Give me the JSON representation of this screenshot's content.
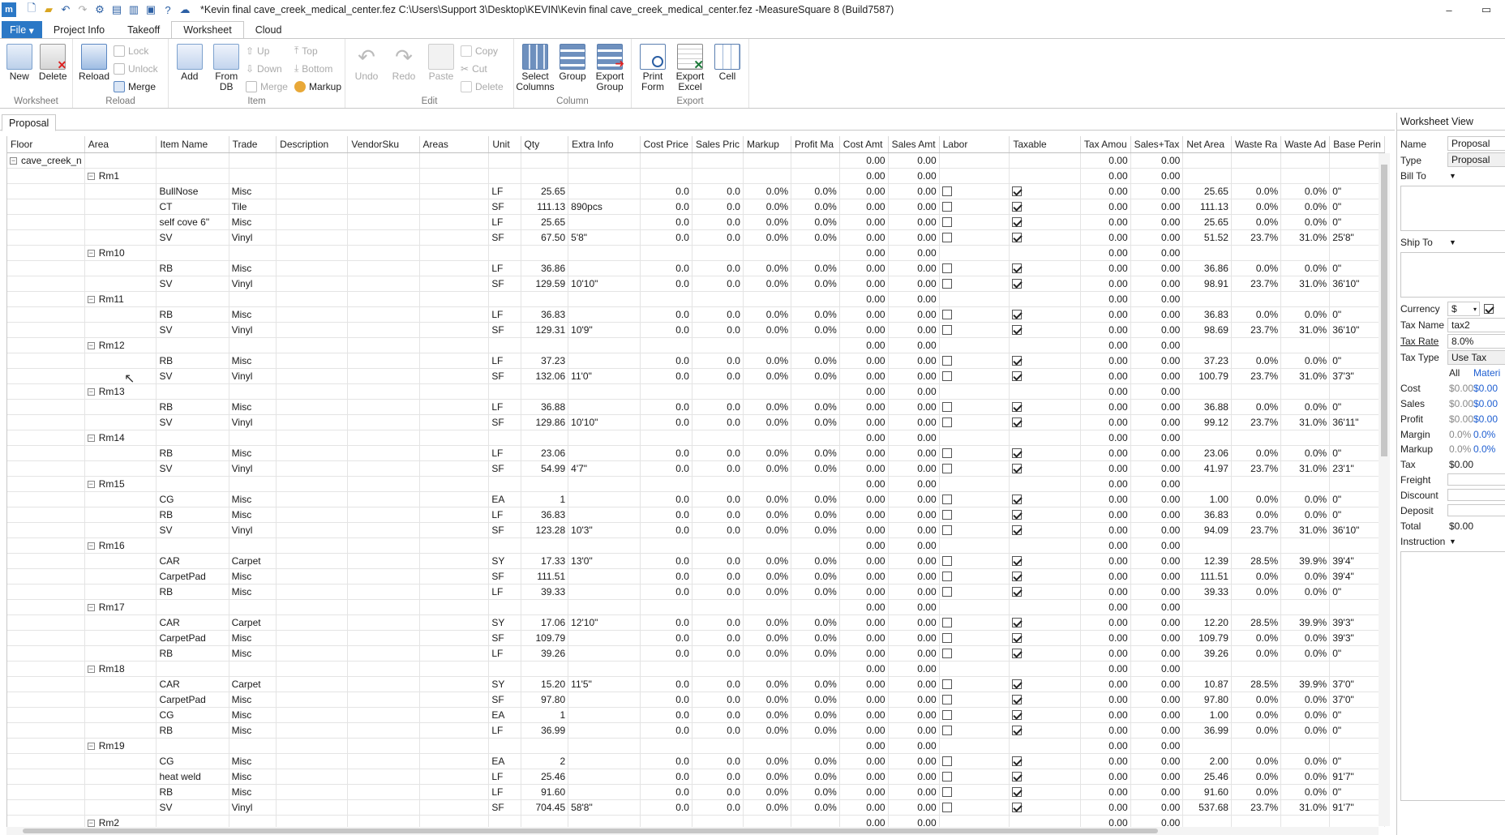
{
  "window": {
    "title": "*Kevin final cave_creek_medical_center.fez C:\\Users\\Support 3\\Desktop\\KEVIN\\Kevin final cave_creek_medical_center.fez -MeasureSquare 8 (Build7587)",
    "logo": "m"
  },
  "ribbon_tabs": [
    "File",
    "Project Info",
    "Takeoff",
    "Worksheet",
    "Cloud"
  ],
  "ribbon": {
    "worksheet_group": {
      "label": "Worksheet",
      "new": "New",
      "delete": "Delete"
    },
    "reload_group": {
      "label": "Reload",
      "reload": "Reload",
      "lock": "Lock",
      "unlock": "Unlock",
      "merge": "Merge"
    },
    "item_group": {
      "label": "Item",
      "add": "Add",
      "from_db": "From\nDB",
      "up": "Up",
      "down": "Down",
      "merge": "Merge",
      "top": "Top",
      "bottom": "Bottom",
      "markup": "Markup"
    },
    "edit_group": {
      "label": "Edit",
      "undo": "Undo",
      "redo": "Redo",
      "paste": "Paste",
      "copy": "Copy",
      "cut": "Cut",
      "delete": "Delete"
    },
    "column_group": {
      "label": "Column",
      "select_columns": "Select\nColumns",
      "group": "Group",
      "export_group": "Export\nGroup"
    },
    "export_group": {
      "label": "Export",
      "print_form": "Print\nForm",
      "export_excel": "Export\nExcel",
      "cell": "Cell"
    }
  },
  "doc_tab": "Proposal",
  "grid": {
    "columns": [
      "Floor",
      "Area",
      "Item Name",
      "Trade",
      "Description",
      "VendorSku",
      "Areas",
      "Unit",
      "Qty",
      "Extra Info",
      "Cost Price",
      "Sales Pric",
      "Markup",
      "Profit Ma",
      "Cost Amt",
      "Sales Amt",
      "Labor",
      "Taxable",
      "Tax Amou",
      "Sales+Tax",
      "Net Area",
      "Waste Ra",
      "Waste Ad",
      "Base Perin"
    ],
    "floor": "cave_creek_n",
    "rooms": [
      {
        "name": "Rm1",
        "items": [
          {
            "item": "BullNose",
            "trade": "Misc",
            "unit": "LF",
            "qty": "25.65",
            "extra": "",
            "net": "25.65",
            "wr": "0.0%",
            "wa": "0.0%",
            "bp": "0\""
          },
          {
            "item": "CT",
            "trade": "Tile",
            "unit": "SF",
            "qty": "111.13",
            "extra": "890pcs",
            "net": "111.13",
            "wr": "0.0%",
            "wa": "0.0%",
            "bp": "0\""
          },
          {
            "item": "self cove 6\"",
            "trade": "Misc",
            "unit": "LF",
            "qty": "25.65",
            "extra": "",
            "net": "25.65",
            "wr": "0.0%",
            "wa": "0.0%",
            "bp": "0\""
          },
          {
            "item": "SV",
            "trade": "Vinyl",
            "unit": "SF",
            "qty": "67.50",
            "extra": "5'8\"",
            "net": "51.52",
            "wr": "23.7%",
            "wa": "31.0%",
            "bp": "25'8\""
          }
        ]
      },
      {
        "name": "Rm10",
        "items": [
          {
            "item": "RB",
            "trade": "Misc",
            "unit": "LF",
            "qty": "36.86",
            "extra": "",
            "net": "36.86",
            "wr": "0.0%",
            "wa": "0.0%",
            "bp": "0\""
          },
          {
            "item": "SV",
            "trade": "Vinyl",
            "unit": "SF",
            "qty": "129.59",
            "extra": "10'10\"",
            "net": "98.91",
            "wr": "23.7%",
            "wa": "31.0%",
            "bp": "36'10\""
          }
        ]
      },
      {
        "name": "Rm11",
        "items": [
          {
            "item": "RB",
            "trade": "Misc",
            "unit": "LF",
            "qty": "36.83",
            "extra": "",
            "net": "36.83",
            "wr": "0.0%",
            "wa": "0.0%",
            "bp": "0\""
          },
          {
            "item": "SV",
            "trade": "Vinyl",
            "unit": "SF",
            "qty": "129.31",
            "extra": "10'9\"",
            "net": "98.69",
            "wr": "23.7%",
            "wa": "31.0%",
            "bp": "36'10\""
          }
        ]
      },
      {
        "name": "Rm12",
        "items": [
          {
            "item": "RB",
            "trade": "Misc",
            "unit": "LF",
            "qty": "37.23",
            "extra": "",
            "net": "37.23",
            "wr": "0.0%",
            "wa": "0.0%",
            "bp": "0\""
          },
          {
            "item": "SV",
            "trade": "Vinyl",
            "unit": "SF",
            "qty": "132.06",
            "extra": "11'0\"",
            "net": "100.79",
            "wr": "23.7%",
            "wa": "31.0%",
            "bp": "37'3\""
          }
        ]
      },
      {
        "name": "Rm13",
        "items": [
          {
            "item": "RB",
            "trade": "Misc",
            "unit": "LF",
            "qty": "36.88",
            "extra": "",
            "net": "36.88",
            "wr": "0.0%",
            "wa": "0.0%",
            "bp": "0\""
          },
          {
            "item": "SV",
            "trade": "Vinyl",
            "unit": "SF",
            "qty": "129.86",
            "extra": "10'10\"",
            "net": "99.12",
            "wr": "23.7%",
            "wa": "31.0%",
            "bp": "36'11\""
          }
        ]
      },
      {
        "name": "Rm14",
        "items": [
          {
            "item": "RB",
            "trade": "Misc",
            "unit": "LF",
            "qty": "23.06",
            "extra": "",
            "net": "23.06",
            "wr": "0.0%",
            "wa": "0.0%",
            "bp": "0\""
          },
          {
            "item": "SV",
            "trade": "Vinyl",
            "unit": "SF",
            "qty": "54.99",
            "extra": "4'7\"",
            "net": "41.97",
            "wr": "23.7%",
            "wa": "31.0%",
            "bp": "23'1\""
          }
        ]
      },
      {
        "name": "Rm15",
        "items": [
          {
            "item": "CG",
            "trade": "Misc",
            "unit": "EA",
            "qty": "1",
            "extra": "",
            "net": "1.00",
            "wr": "0.0%",
            "wa": "0.0%",
            "bp": "0\""
          },
          {
            "item": "RB",
            "trade": "Misc",
            "unit": "LF",
            "qty": "36.83",
            "extra": "",
            "net": "36.83",
            "wr": "0.0%",
            "wa": "0.0%",
            "bp": "0\""
          },
          {
            "item": "SV",
            "trade": "Vinyl",
            "unit": "SF",
            "qty": "123.28",
            "extra": "10'3\"",
            "net": "94.09",
            "wr": "23.7%",
            "wa": "31.0%",
            "bp": "36'10\""
          }
        ]
      },
      {
        "name": "Rm16",
        "items": [
          {
            "item": "CAR",
            "trade": "Carpet",
            "unit": "SY",
            "qty": "17.33",
            "extra": "13'0\"",
            "net": "12.39",
            "wr": "28.5%",
            "wa": "39.9%",
            "bp": "39'4\""
          },
          {
            "item": "CarpetPad",
            "trade": "Misc",
            "unit": "SF",
            "qty": "111.51",
            "extra": "",
            "net": "111.51",
            "wr": "0.0%",
            "wa": "0.0%",
            "bp": "39'4\""
          },
          {
            "item": "RB",
            "trade": "Misc",
            "unit": "LF",
            "qty": "39.33",
            "extra": "",
            "net": "39.33",
            "wr": "0.0%",
            "wa": "0.0%",
            "bp": "0\""
          }
        ]
      },
      {
        "name": "Rm17",
        "items": [
          {
            "item": "CAR",
            "trade": "Carpet",
            "unit": "SY",
            "qty": "17.06",
            "extra": "12'10\"",
            "net": "12.20",
            "wr": "28.5%",
            "wa": "39.9%",
            "bp": "39'3\""
          },
          {
            "item": "CarpetPad",
            "trade": "Misc",
            "unit": "SF",
            "qty": "109.79",
            "extra": "",
            "net": "109.79",
            "wr": "0.0%",
            "wa": "0.0%",
            "bp": "39'3\""
          },
          {
            "item": "RB",
            "trade": "Misc",
            "unit": "LF",
            "qty": "39.26",
            "extra": "",
            "net": "39.26",
            "wr": "0.0%",
            "wa": "0.0%",
            "bp": "0\""
          }
        ]
      },
      {
        "name": "Rm18",
        "items": [
          {
            "item": "CAR",
            "trade": "Carpet",
            "unit": "SY",
            "qty": "15.20",
            "extra": "11'5\"",
            "net": "10.87",
            "wr": "28.5%",
            "wa": "39.9%",
            "bp": "37'0\""
          },
          {
            "item": "CarpetPad",
            "trade": "Misc",
            "unit": "SF",
            "qty": "97.80",
            "extra": "",
            "net": "97.80",
            "wr": "0.0%",
            "wa": "0.0%",
            "bp": "37'0\""
          },
          {
            "item": "CG",
            "trade": "Misc",
            "unit": "EA",
            "qty": "1",
            "extra": "",
            "net": "1.00",
            "wr": "0.0%",
            "wa": "0.0%",
            "bp": "0\""
          },
          {
            "item": "RB",
            "trade": "Misc",
            "unit": "LF",
            "qty": "36.99",
            "extra": "",
            "net": "36.99",
            "wr": "0.0%",
            "wa": "0.0%",
            "bp": "0\""
          }
        ]
      },
      {
        "name": "Rm19",
        "items": [
          {
            "item": "CG",
            "trade": "Misc",
            "unit": "EA",
            "qty": "2",
            "extra": "",
            "net": "2.00",
            "wr": "0.0%",
            "wa": "0.0%",
            "bp": "0\""
          },
          {
            "item": "heat weld",
            "trade": "Misc",
            "unit": "LF",
            "qty": "25.46",
            "extra": "",
            "net": "25.46",
            "wr": "0.0%",
            "wa": "0.0%",
            "bp": "91'7\""
          },
          {
            "item": "RB",
            "trade": "Misc",
            "unit": "LF",
            "qty": "91.60",
            "extra": "",
            "net": "91.60",
            "wr": "0.0%",
            "wa": "0.0%",
            "bp": "0\""
          },
          {
            "item": "SV",
            "trade": "Vinyl",
            "unit": "SF",
            "qty": "704.45",
            "extra": "58'8\"",
            "net": "537.68",
            "wr": "23.7%",
            "wa": "31.0%",
            "bp": "91'7\""
          }
        ]
      },
      {
        "name": "Rm2",
        "items": []
      }
    ],
    "defaults": {
      "cost_price": "0.0",
      "sales_price": "0.0",
      "markup": "0.0%",
      "profit_margin": "0.0%",
      "cost_amt": "0.00",
      "sales_amt": "0.00",
      "tax_amount": "0.00",
      "sales_tax": "0.00"
    }
  },
  "panel": {
    "title": "Worksheet View",
    "name_label": "Name",
    "name_value": "Proposal",
    "type_label": "Type",
    "type_value": "Proposal",
    "bill_to_label": "Bill To",
    "ship_to_label": "Ship To",
    "currency_label": "Currency",
    "currency_value": "$",
    "tax_name_label": "Tax Name",
    "tax_name_value": "tax2",
    "tax_rate_label": "Tax Rate",
    "tax_rate_value": "8.0%",
    "tax_type_label": "Tax Type",
    "tax_type_value": "Use Tax",
    "col_all": "All",
    "col_mater": "Materi",
    "cost_label": "Cost",
    "cost_all": "$0.00",
    "cost_mat": "$0.00",
    "sales_label": "Sales",
    "sales_all": "$0.00",
    "sales_mat": "$0.00",
    "profit_label": "Profit",
    "profit_all": "$0.00",
    "profit_mat": "$0.00",
    "margin_label": "Margin",
    "margin_all": "0.0%",
    "margin_mat": "0.0%",
    "markup_label": "Markup",
    "markup_all": "0.0%",
    "markup_mat": "0.0%",
    "tax_label": "Tax",
    "tax_value": "$0.00",
    "freight_label": "Freight",
    "discount_label": "Discount",
    "deposit_label": "Deposit",
    "total_label": "Total",
    "total_value": "$0.00",
    "instruction_label": "Instruction"
  },
  "colors": {
    "accent": "#2b78c6",
    "link": "#1f5fd1"
  }
}
